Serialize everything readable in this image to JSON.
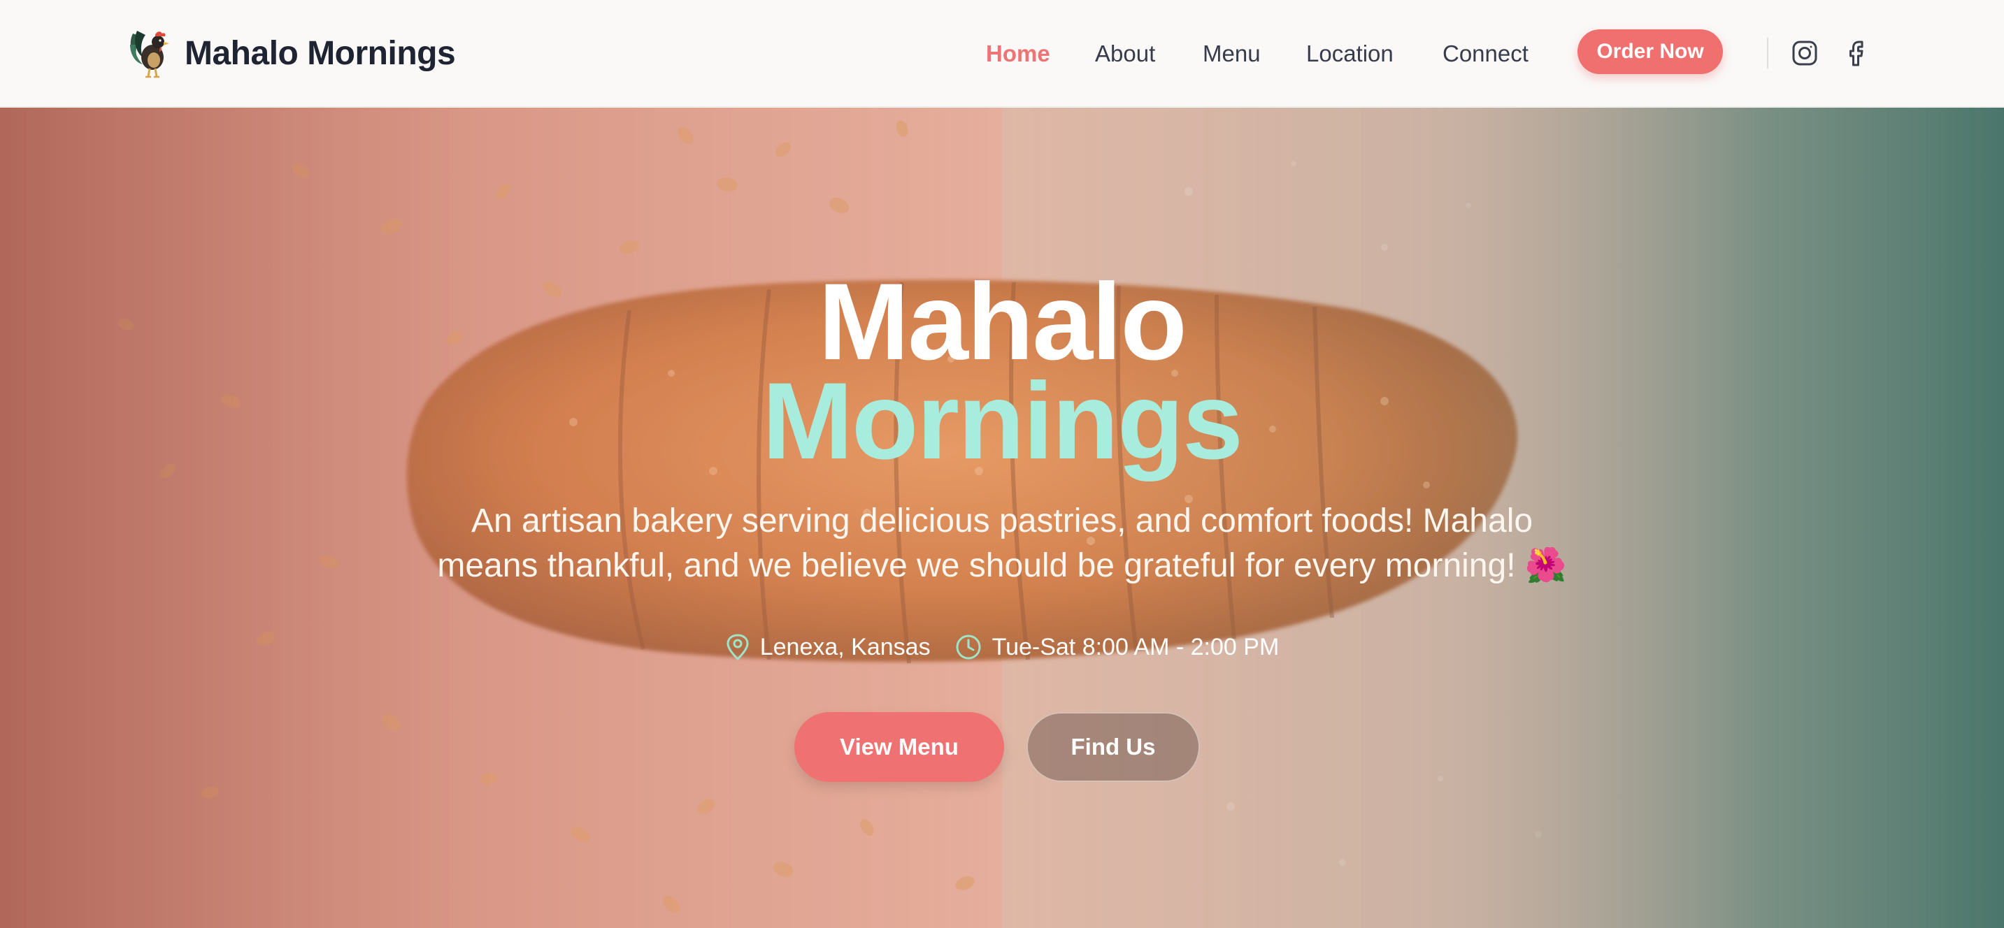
{
  "brand": {
    "name": "Mahalo Mornings"
  },
  "nav": {
    "items": [
      {
        "label": "Home",
        "active": true
      },
      {
        "label": "About"
      },
      {
        "label": "Menu"
      },
      {
        "label": "Location"
      },
      {
        "label": "Connect"
      }
    ],
    "order_label": "Order Now",
    "social": [
      "instagram-icon",
      "facebook-icon"
    ]
  },
  "hero": {
    "title_line1": "Mahalo",
    "title_line2": "Mornings",
    "tagline_line1": "An artisan bakery serving delicious pastries, and comfort foods! Mahalo",
    "tagline_line2": "means thankful, and we believe we should be grateful for every morning! 🌺",
    "location": "Lenexa, Kansas",
    "hours": "Tue-Sat 8:00 AM - 2:00 PM",
    "primary_cta": "View Menu",
    "secondary_cta": "Find Us"
  },
  "colors": {
    "accent": "#f07070",
    "mint": "#a7ecdd",
    "text_dark": "#1f2433",
    "nav_text": "#363c4b"
  }
}
